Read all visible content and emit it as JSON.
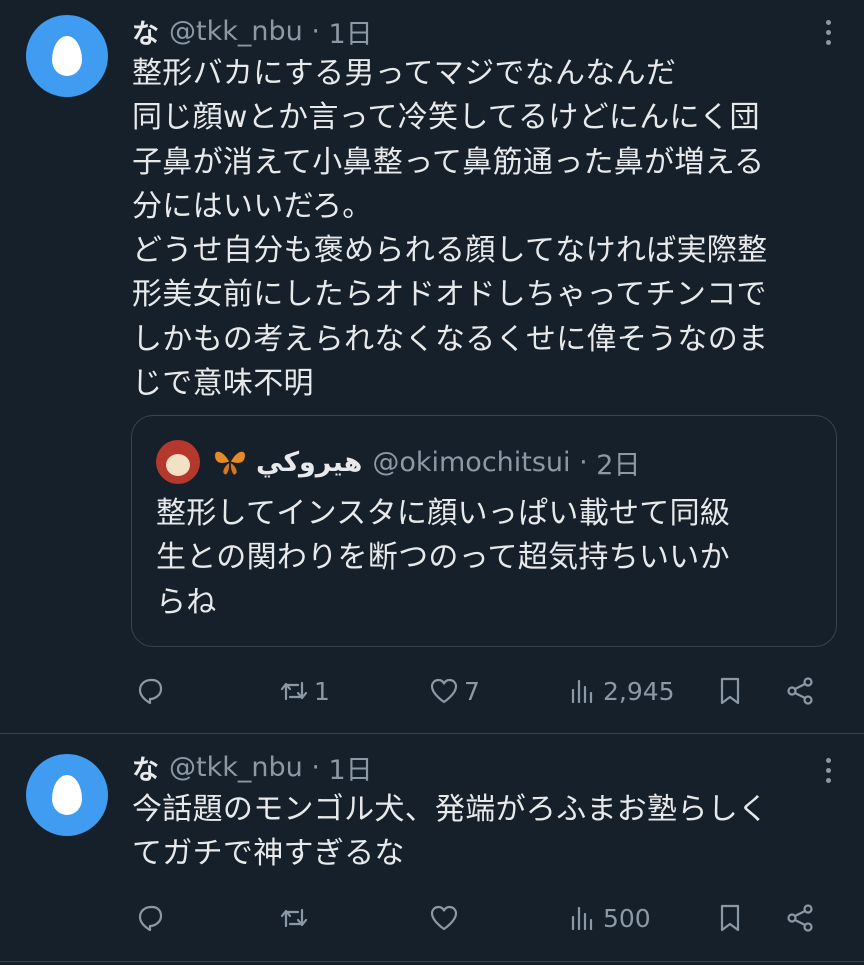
{
  "tweets": [
    {
      "name": "な",
      "handle": "@tkk_nbu",
      "time": "1日",
      "text": "整形バカにする男ってマジでなんなんだ\n同じ顔wとか言って冷笑してるけどにんにく団\n子鼻が消えて小鼻整って鼻筋通った鼻が増える\n分にはいいだろ。\nどうせ自分も褒められる顔してなければ実際整\n形美女前にしたらオドオドしちゃってチンコで\nしかもの考えられなくなるくせに偉そうなのま\nじで意味不明",
      "quote": {
        "name": "هيروكي",
        "handle": "@okimochitsui",
        "time": "2日",
        "text": "整形してインスタに顔いっぱい載せて同級\n生との関わりを断つのって超気持ちいいか\nらね"
      },
      "actions": {
        "reply": "",
        "retweet": "1",
        "like": "7",
        "views": "2,945"
      }
    },
    {
      "name": "な",
      "handle": "@tkk_nbu",
      "time": "1日",
      "text": "今話題のモンゴル犬、発端がろふまお塾らしく\nてガチで神すぎるな",
      "actions": {
        "reply": "",
        "retweet": "",
        "like": "",
        "views": "500"
      }
    }
  ],
  "icons": [
    "reply-icon",
    "retweet-icon",
    "like-icon",
    "views-icon",
    "bookmark-icon",
    "share-icon",
    "more-icon"
  ],
  "colors": {
    "background": "#15202b",
    "text": "#e7e9ea",
    "secondary": "#8b98a5",
    "avatar": "#3f9cf0",
    "border": "#38444d"
  }
}
